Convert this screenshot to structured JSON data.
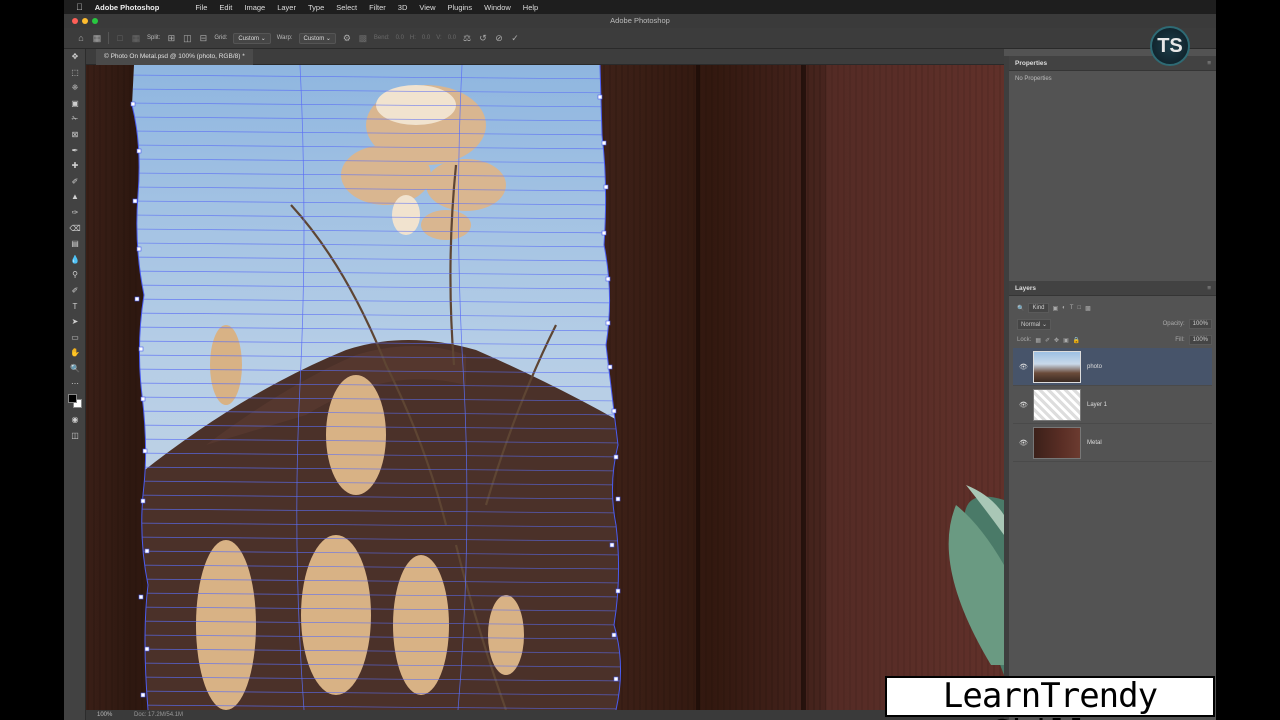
{
  "menubar": {
    "app_name": "Adobe Photoshop",
    "items": [
      "File",
      "Edit",
      "Image",
      "Layer",
      "Type",
      "Select",
      "Filter",
      "3D",
      "View",
      "Plugins",
      "Window",
      "Help"
    ]
  },
  "window": {
    "title": "Adobe Photoshop"
  },
  "options": {
    "split_label": "Split:",
    "grid_label": "Grid:",
    "grid_value": "Custom",
    "warp_label": "Warp:",
    "warp_value": "Custom",
    "bend_label": "Bend:",
    "bend_value": "0.0",
    "h_label": "H:",
    "h_value": "0.0",
    "v_label": "V:",
    "v_value": "0.0"
  },
  "document": {
    "tab_title": "© Photo On Metal.psd @ 100% (photo, RGB/8) *"
  },
  "status": {
    "zoom": "100%",
    "doc_info": "Doc: 17.2M/54.1M"
  },
  "properties": {
    "title": "Properties",
    "body": "No Properties"
  },
  "layers_panel": {
    "title": "Layers",
    "filter_placeholder": "Kind",
    "blend_mode": "Normal",
    "opacity_label": "Opacity:",
    "opacity_value": "100%",
    "lock_label": "Lock:",
    "fill_label": "Fill:",
    "fill_value": "100%",
    "layers": [
      {
        "name": "photo",
        "active": true
      },
      {
        "name": "Layer 1",
        "active": false
      },
      {
        "name": "Metal",
        "active": false
      }
    ]
  },
  "logo": {
    "text": "TS"
  },
  "watermark": {
    "text": "LearnTrendy Skills"
  },
  "colors": {
    "accent_selection": "#47546a",
    "grid_line": "#5b6ef5"
  }
}
